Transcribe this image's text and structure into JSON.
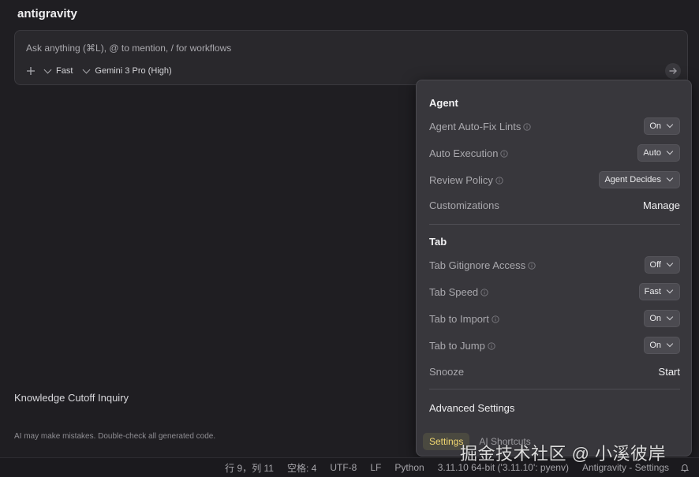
{
  "app": {
    "title": "antigravity"
  },
  "prompt": {
    "placeholder": "Ask anything (⌘L), @ to mention, / for workflows",
    "mode_label": "Fast",
    "model_label": "Gemini 3 Pro (High)"
  },
  "conversation": {
    "title": "Knowledge Cutoff Inquiry",
    "disclaimer": "AI may make mistakes. Double-check all generated code."
  },
  "settings_popup": {
    "agent": {
      "title": "Agent",
      "rows": [
        {
          "label": "Agent Auto-Fix Lints",
          "value": "On"
        },
        {
          "label": "Auto Execution",
          "value": "Auto"
        },
        {
          "label": "Review Policy",
          "value": "Agent Decides"
        },
        {
          "label": "Customizations",
          "action": "Manage"
        }
      ]
    },
    "tab": {
      "title": "Tab",
      "rows": [
        {
          "label": "Tab Gitignore Access",
          "value": "Off"
        },
        {
          "label": "Tab Speed",
          "value": "Fast"
        },
        {
          "label": "Tab to Import",
          "value": "On"
        },
        {
          "label": "Tab to Jump",
          "value": "On"
        },
        {
          "label": "Snooze",
          "action": "Start"
        }
      ]
    },
    "advanced": "Advanced Settings",
    "tabs": [
      "Settings",
      "AI Shortcuts"
    ]
  },
  "statusbar": {
    "position": "行 9，列 11",
    "spaces": "空格: 4",
    "encoding": "UTF-8",
    "eol": "LF",
    "language": "Python",
    "interpreter": "3.11.10 64-bit ('3.11.10': pyenv)",
    "context": "Antigravity - Settings"
  },
  "watermark": "掘金技术社区 @ 小溪彼岸",
  "colors": {
    "background": "#1f1e22",
    "popup": "#38373c",
    "active_tab_text": "#f0d670"
  }
}
